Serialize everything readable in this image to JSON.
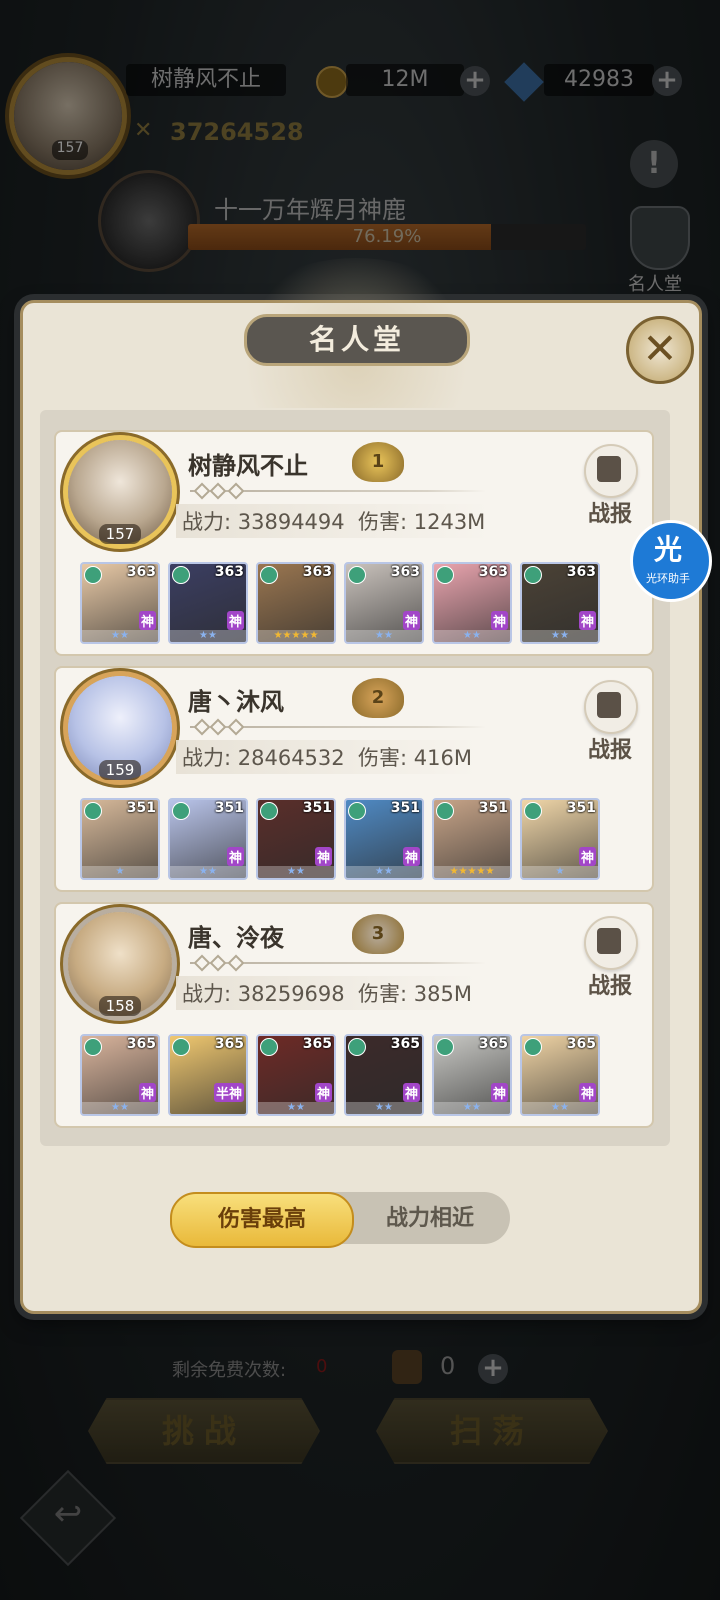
{
  "hud": {
    "player_name": "树静风不止",
    "player_level": "157",
    "gold": "12M",
    "gems": "42983",
    "power": "37264528",
    "boss_name": "十一万年辉月神鹿",
    "boss_progress_text": "76.19%",
    "boss_progress": 0.7619,
    "side_hall_label": "名人堂"
  },
  "modal": {
    "title": "名人堂",
    "close": "✕",
    "entries": [
      {
        "name": "树静风不止",
        "rank": "1",
        "level": "157",
        "stats": "战力: 33894494  伤害: 1243M",
        "report": "战报",
        "heroes": [
          {
            "level": "363",
            "badge": "神",
            "stars": "★★",
            "bg": "#e8c9a6"
          },
          {
            "level": "363",
            "badge": "神",
            "stars": "★★",
            "bg": "#3b3e62"
          },
          {
            "level": "363",
            "badge": "",
            "stars": "★★★★★",
            "bg": "#9a7650"
          },
          {
            "level": "363",
            "badge": "神",
            "stars": "★★",
            "bg": "#c9c2bc"
          },
          {
            "level": "363",
            "badge": "神",
            "stars": "★★",
            "bg": "#e9a4ae"
          },
          {
            "level": "363",
            "badge": "神",
            "stars": "★★",
            "bg": "#4b4236"
          }
        ]
      },
      {
        "name": "唐丶沐风",
        "rank": "2",
        "level": "159",
        "stats": "战力: 28464532  伤害: 416M",
        "report": "战报",
        "heroes": [
          {
            "level": "351",
            "badge": "",
            "stars": "★",
            "bg": "#d7b99a"
          },
          {
            "level": "351",
            "badge": "神",
            "stars": "★★",
            "bg": "#b9c4ea"
          },
          {
            "level": "351",
            "badge": "神",
            "stars": "★★",
            "bg": "#5a2e2a"
          },
          {
            "level": "351",
            "badge": "神",
            "stars": "★★",
            "bg": "#4f8ac4"
          },
          {
            "level": "351",
            "badge": "",
            "stars": "★★★★★",
            "bg": "#c7a488"
          },
          {
            "level": "351",
            "badge": "神",
            "stars": "★",
            "bg": "#f0d6a8"
          }
        ]
      },
      {
        "name": "唐、泠夜",
        "rank": "3",
        "level": "158",
        "stats": "战力: 38259698  伤害: 385M",
        "report": "战报",
        "heroes": [
          {
            "level": "365",
            "badge": "神",
            "stars": "★★",
            "bg": "#d9b49c"
          },
          {
            "level": "365",
            "badge": "半神",
            "stars": "",
            "bg": "#f0c870"
          },
          {
            "level": "365",
            "badge": "神",
            "stars": "★★",
            "bg": "#6e2a26"
          },
          {
            "level": "365",
            "badge": "神",
            "stars": "★★",
            "bg": "#3c2a2a"
          },
          {
            "level": "365",
            "badge": "神",
            "stars": "★★",
            "bg": "#c8c8c4"
          },
          {
            "level": "365",
            "badge": "神",
            "stars": "★★",
            "bg": "#efd3a4"
          }
        ]
      }
    ],
    "tabs": {
      "active": "伤害最高",
      "other": "战力相近"
    }
  },
  "assistant": {
    "char": "光",
    "label": "光环助手"
  },
  "bottom": {
    "free_label": "剩余免费次数:",
    "free_value": "0",
    "ticket_count": "0",
    "challenge": "挑战",
    "sweep": "扫荡"
  },
  "icons": {
    "back": "back-arrow-icon",
    "close": "close-icon",
    "report": "document-icon",
    "plus": "plus-icon",
    "alert": "exclamation-icon"
  }
}
